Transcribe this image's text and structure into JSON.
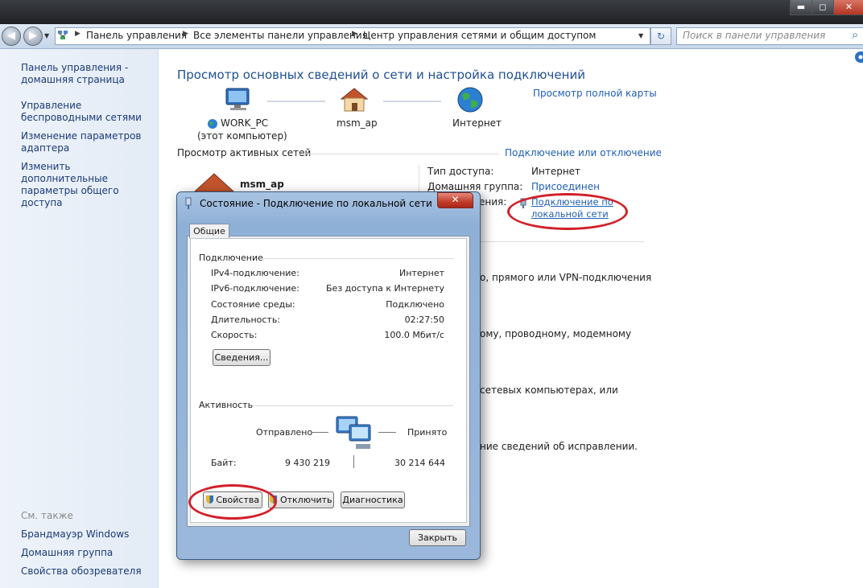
{
  "window": {
    "minimize_glyph": "▬",
    "maximize_glyph": "◻",
    "close_glyph": "✕"
  },
  "addressbar": {
    "back_glyph": "◀",
    "forward_glyph": "▶",
    "crumbs": [
      "Панель управления",
      "Все элементы панели управления",
      "Центр управления сетями и общим доступом"
    ],
    "refresh_glyph": "↻",
    "search_placeholder": "Поиск в панели управления",
    "search_glyph": "⌕"
  },
  "sidebar": {
    "home_link": "Панель управления - домашняя страница",
    "items": [
      "Управление беспроводными сетями",
      "Изменение параметров адаптера",
      "Изменить дополнительные параметры общего доступа"
    ],
    "see_also_title": "См. также",
    "see_also": [
      "Брандмауэр Windows",
      "Домашняя группа",
      "Свойства обозревателя"
    ]
  },
  "main": {
    "title": "Просмотр основных сведений о сети и настройка подключений",
    "full_map_link": "Просмотр полной карты",
    "map": {
      "computer_name": "WORK_PC",
      "computer_sub": "(этот компьютер)",
      "network_name": "msm_ap",
      "internet_label": "Интернет"
    },
    "active_networks_title": "Просмотр активных сетей",
    "connect_disconnect_link": "Подключение или отключение",
    "active_network_name": "msm_ap",
    "access_type_label": "Тип доступа:",
    "access_type_value": "Интернет",
    "homegroup_label": "Домашняя группа:",
    "homegroup_value": "Присоединен",
    "connections_label_tail": "ения:",
    "connection_link_line1": "Подключение по",
    "connection_link_line2": "локальной сети",
    "obscured_lines": [
      "о, прямого или VPN-подключения",
      "ому, проводному, модемному",
      "сетевых компьютерах, или",
      "ние сведений об исправлении."
    ]
  },
  "dialog": {
    "title": "Состояние - Подключение по локальной сети",
    "close_glyph": "✕",
    "tab_general": "Общие",
    "connection_group": "Подключение",
    "rows": [
      {
        "label": "IPv4-подключение:",
        "value": "Интернет"
      },
      {
        "label": "IPv6-подключение:",
        "value": "Без доступа к Интернету"
      },
      {
        "label": "Состояние среды:",
        "value": "Подключено"
      },
      {
        "label": "Длительность:",
        "value": "02:27:50"
      },
      {
        "label": "Скорость:",
        "value": "100.0 Мбит/с"
      }
    ],
    "details_button": "Сведения...",
    "activity_group": "Активность",
    "sent_label": "Отправлено",
    "received_label": "Принято",
    "bytes_label": "Байт:",
    "bytes_sent": "9 430 219",
    "bytes_received": "30 214 644",
    "properties_button": "Свойства",
    "disable_button": "Отключить",
    "diagnose_button": "Диагностика",
    "close_button": "Закрыть"
  },
  "colors": {
    "annotation_red": "#d2202a",
    "link_blue": "#1f5fb4",
    "heading_blue": "#1e4f94"
  }
}
